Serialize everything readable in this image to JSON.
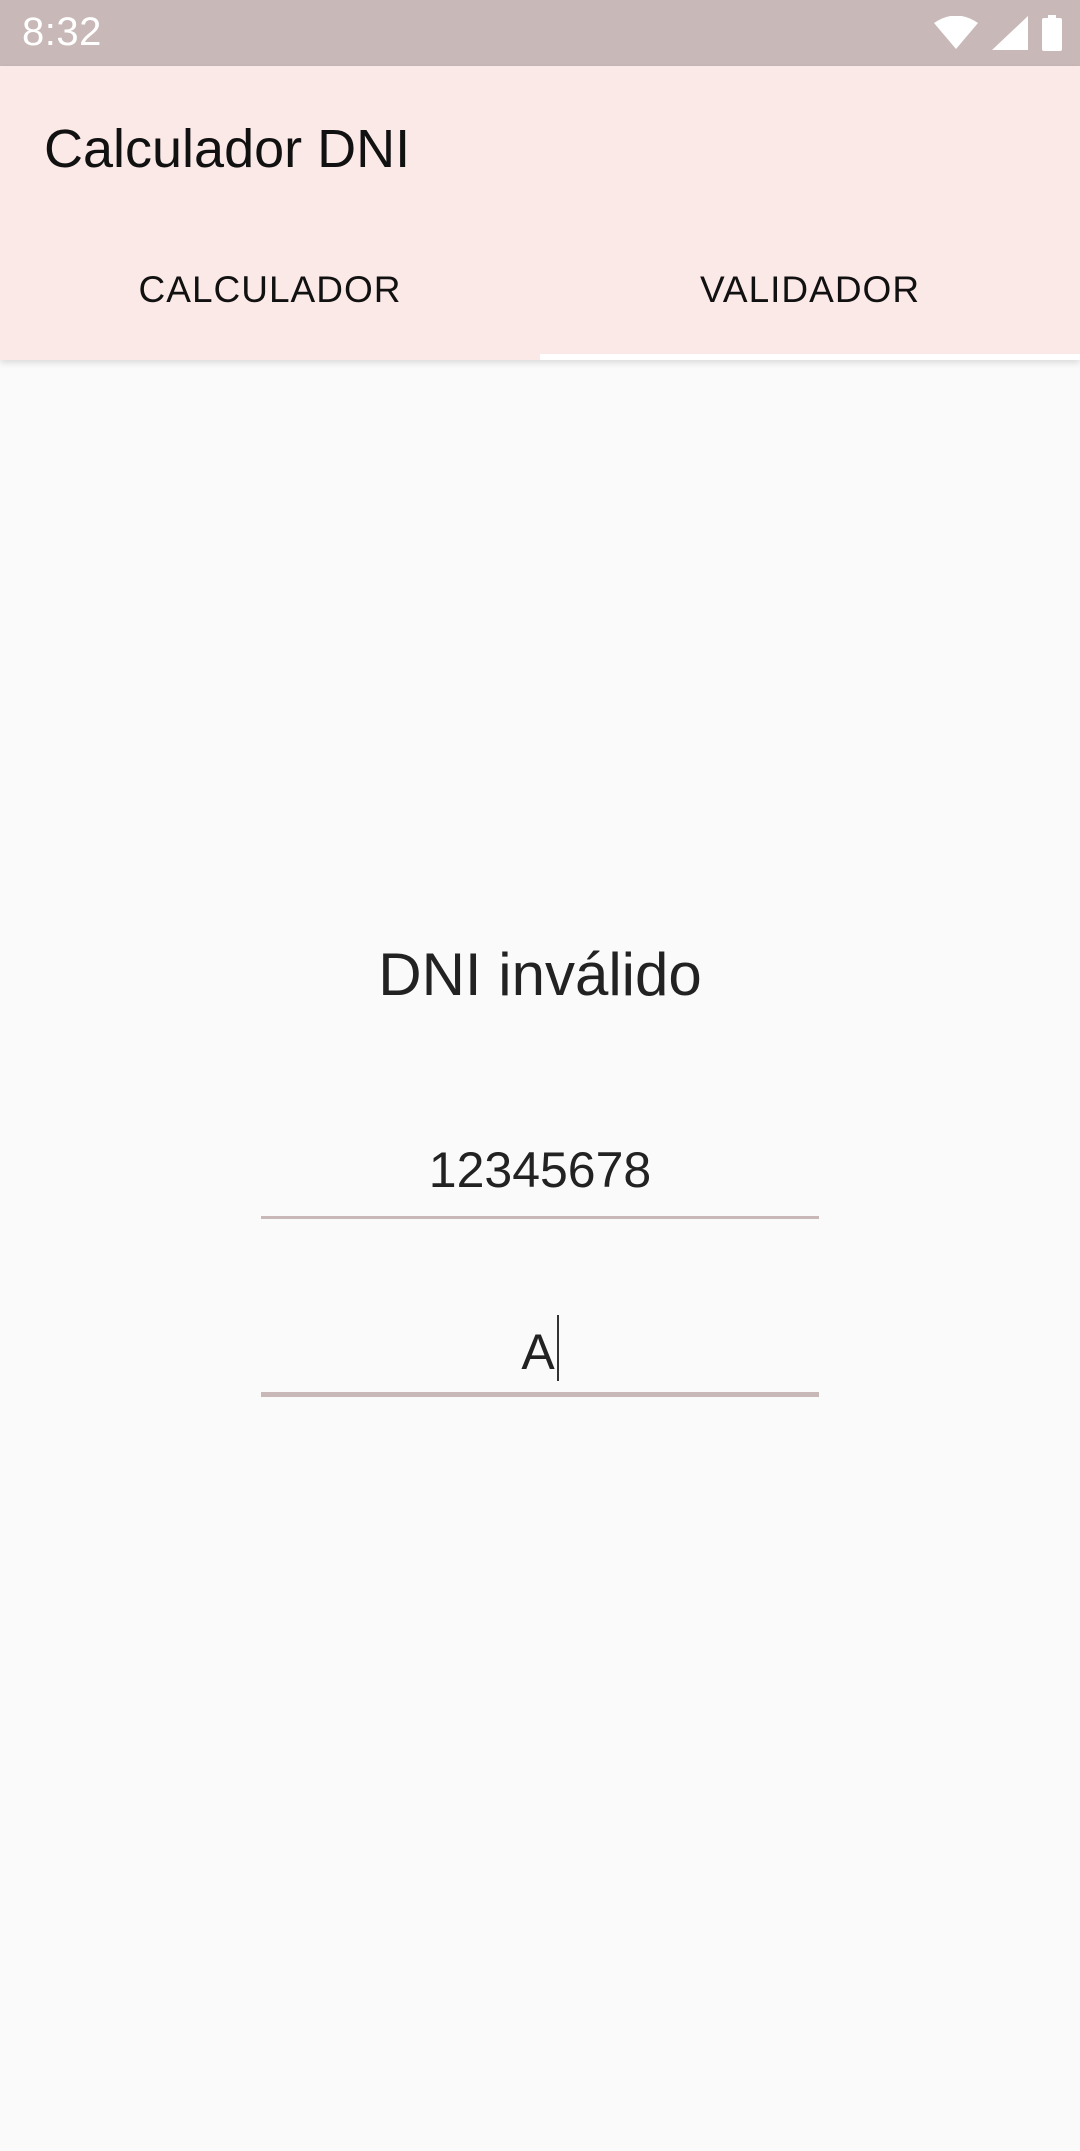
{
  "status_bar": {
    "time": "8:32",
    "icons": [
      "wifi-icon",
      "signal-icon",
      "battery-icon"
    ]
  },
  "app_bar": {
    "title": "Calculador DNI",
    "tabs": [
      {
        "label": "CALCULADOR",
        "selected": false
      },
      {
        "label": "VALIDADOR",
        "selected": true
      }
    ]
  },
  "validator": {
    "result": "DNI inválido",
    "number_value": "12345678",
    "letter_value": "A"
  },
  "colors": {
    "status_bar": "#c8b8b7",
    "app_bar": "#fbe9e7",
    "background": "#fafafa",
    "field_underline": "#c8b8b7"
  }
}
